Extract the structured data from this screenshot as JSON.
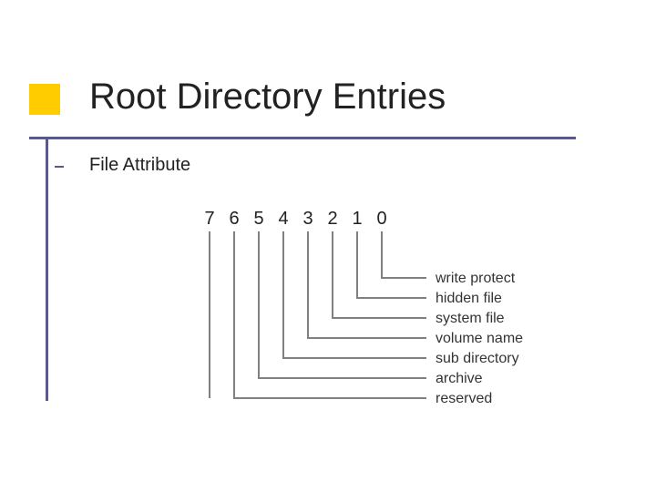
{
  "title": "Root Directory Entries",
  "subtitle": "File Attribute",
  "bits": {
    "b7": "7",
    "b6": "6",
    "b5": "5",
    "b4": "4",
    "b3": "3",
    "b2": "2",
    "b1": "1",
    "b0": "0"
  },
  "labels": {
    "l0": "write protect",
    "l1": "hidden file",
    "l2": "system file",
    "l3": "volume name",
    "l4": "sub directory",
    "l5": "archive",
    "l6": "reserved"
  },
  "colors": {
    "accent": "#ffcc00",
    "line": "#5a5a8a",
    "wire": "#808080"
  }
}
